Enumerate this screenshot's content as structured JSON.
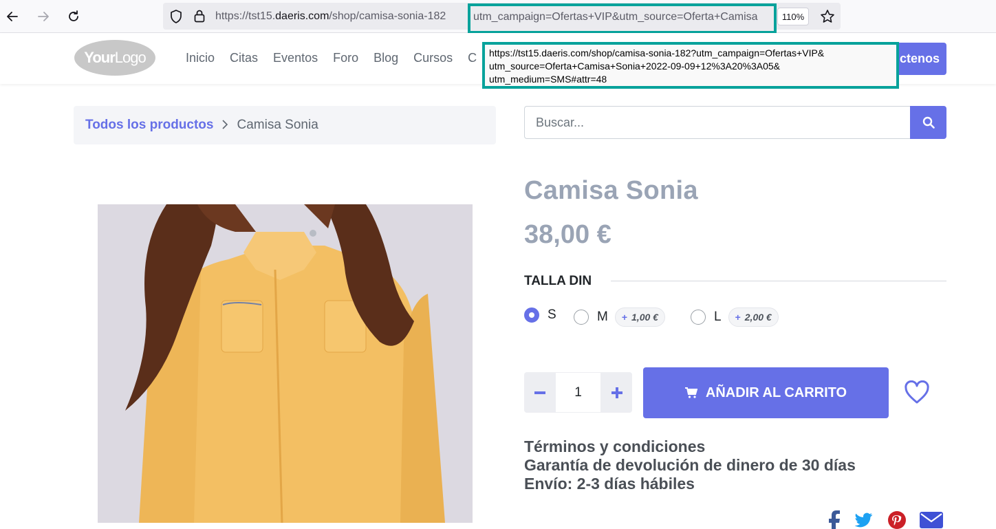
{
  "browser": {
    "url_prefix": "https://tst15.",
    "url_host": "daeris.com",
    "url_path": "/shop/camisa-sonia-182",
    "url_highlighted": "utm_campaign=Ofertas+VIP&utm_source=Oferta+Camisa",
    "zoom": "110%",
    "tooltip_lines": [
      "https://tst15.daeris.com/shop/camisa-sonia-182?utm_campaign=Ofertas+VIP&",
      "utm_source=Oferta+Camisa+Sonia+2022-09-09+12%3A20%3A05&",
      "utm_medium=SMS#attr=48"
    ],
    "highlight_color": "#06a29b"
  },
  "header": {
    "logo_your": "Your",
    "logo_logo": "Logo",
    "menu": [
      "Inicio",
      "Citas",
      "Eventos",
      "Foro",
      "Blog",
      "Cursos",
      "C"
    ],
    "contact_label": "ctenos"
  },
  "breadcrumb": {
    "link": "Todos los productos",
    "current": "Camisa Sonia"
  },
  "search": {
    "placeholder": "Buscar..."
  },
  "product": {
    "title": "Camisa Sonia",
    "price": "38,00 €",
    "attribute_title": "TALLA DIN",
    "options": [
      {
        "label": "S",
        "selected": true,
        "extra": ""
      },
      {
        "label": "M",
        "selected": false,
        "extra": "1,00 €"
      },
      {
        "label": "L",
        "selected": false,
        "extra": "2,00 €"
      }
    ],
    "extra_plus": "+",
    "quantity": "1",
    "add_to_cart": "AÑADIR AL CARRITO",
    "terms": [
      "Términos y condiciones",
      "Garantía de devolución de dinero de 30 días",
      "Envío: 2-3 días hábiles"
    ]
  },
  "colors": {
    "accent": "#6670e7",
    "title_gray": "#9aa4b5",
    "facebook": "#3b5998",
    "twitter": "#1da1f2",
    "pinterest": "#cb2027",
    "email": "#3f51d5"
  }
}
